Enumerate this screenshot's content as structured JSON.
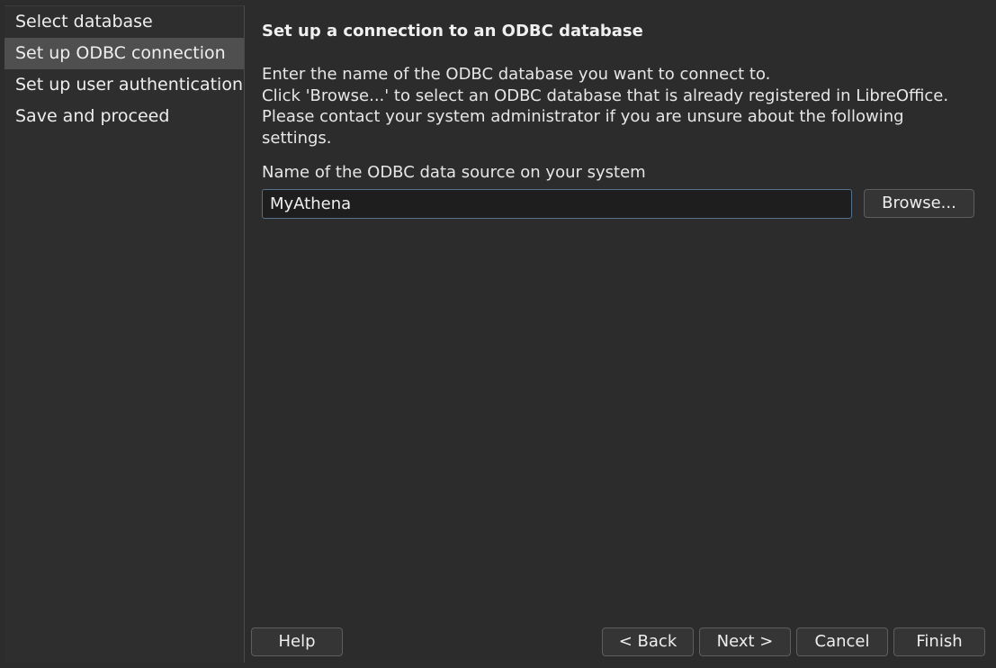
{
  "sidebar": {
    "items": [
      {
        "label": "Select database"
      },
      {
        "label": "Set up ODBC connection"
      },
      {
        "label": "Set up user authentication"
      },
      {
        "label": "Save and proceed"
      }
    ],
    "active_index": 1
  },
  "main": {
    "title": "Set up a connection to an ODBC database",
    "description": [
      "Enter the name of the ODBC database you want to connect to.",
      "Click 'Browse...' to select an ODBC database that is already registered in LibreOffice.",
      "Please contact your system administrator if you are unsure about the following settings."
    ],
    "field_label": "Name of the ODBC data source on your system",
    "datasource_value": "MyAthena",
    "browse_label": "Browse..."
  },
  "footer": {
    "help_label": "Help",
    "back_label": "< Back",
    "next_label": "Next >",
    "cancel_label": "Cancel",
    "finish_label": "Finish"
  },
  "colors": {
    "background": "#2c2c2c",
    "active_item": "#4f4f4f",
    "input_focus_border": "#56708f"
  }
}
